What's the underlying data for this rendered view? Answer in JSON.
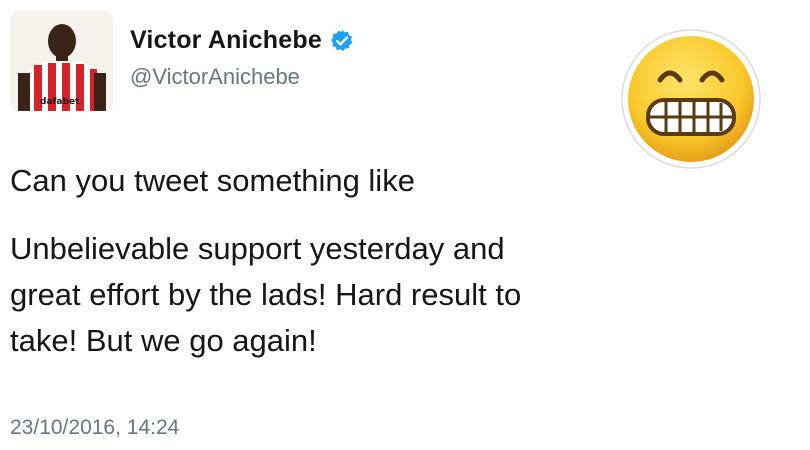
{
  "user": {
    "display_name": "Victor Anichebe",
    "handle": "@VictorAnichebe",
    "avatar_text": "dafabet",
    "verified": true
  },
  "tweet": {
    "line1": "Can you tweet something like",
    "line2": "Unbelievable support yesterday and",
    "line3": "great effort by the lads! Hard result to",
    "line4": "take! But we go again!"
  },
  "timestamp": "23/10/2016, 14:24",
  "icons": {
    "verified": "verified-badge-icon",
    "emoji": "grimacing-face-icon"
  },
  "colors": {
    "verified_blue": "#1da1f2",
    "text": "#14171a",
    "muted": "#657786",
    "emoji_yellow": "#f8c82a"
  }
}
